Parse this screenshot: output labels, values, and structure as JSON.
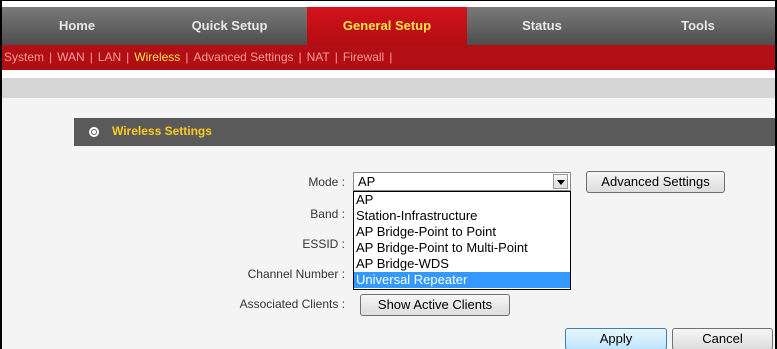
{
  "nav": {
    "tabs": [
      {
        "label": "Home"
      },
      {
        "label": "Quick Setup"
      },
      {
        "label": "General Setup"
      },
      {
        "label": "Status"
      },
      {
        "label": "Tools"
      }
    ]
  },
  "subnav": {
    "items": [
      {
        "label": "System"
      },
      {
        "label": "WAN"
      },
      {
        "label": "LAN"
      },
      {
        "label": "Wireless"
      },
      {
        "label": "Advanced Settings"
      },
      {
        "label": "NAT"
      },
      {
        "label": "Firewall"
      }
    ]
  },
  "section": {
    "title": "Wireless Settings"
  },
  "form": {
    "mode_label": "Mode :",
    "band_label": "Band :",
    "essid_label": "ESSID :",
    "channel_label": "Channel Number :",
    "clients_label": "Associated Clients :",
    "mode_value": "AP",
    "mode_options": [
      "AP",
      "Station-Infrastructure",
      "AP Bridge-Point to Point",
      "AP Bridge-Point to Multi-Point",
      "AP Bridge-WDS",
      "Universal Repeater"
    ],
    "highlighted_option": "Universal Repeater"
  },
  "buttons": {
    "advanced": "Advanced Settings",
    "show_clients": "Show Active Clients",
    "apply": "Apply",
    "cancel": "Cancel"
  },
  "colors": {
    "accent_red": "#b20f14",
    "active_yellow": "#ffe44a",
    "highlight_blue": "#3399ff"
  }
}
